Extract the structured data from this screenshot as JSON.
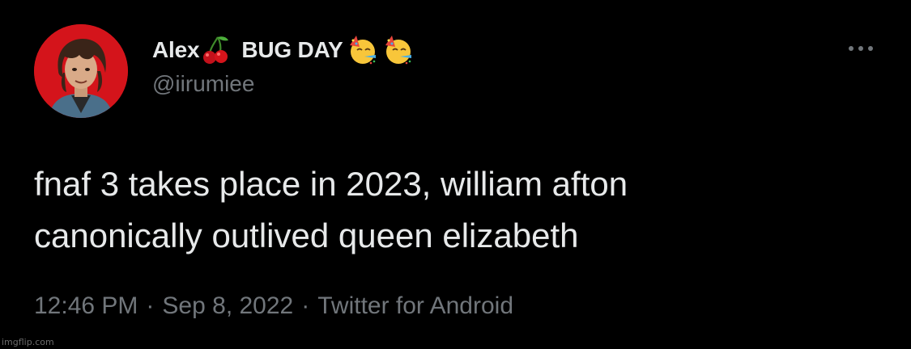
{
  "tweet": {
    "display_name": "Alex",
    "display_name_suffix": "BUG DAY",
    "name_emojis": [
      "cherries-icon",
      "partying-face-icon",
      "partying-face-icon"
    ],
    "handle": "@iirumiee",
    "text_line_1": "fnaf 3 takes place in 2023, william afton",
    "text_line_2": "canonically outlived queen elizabeth",
    "time": "12:46 PM",
    "date": "Sep 8, 2022",
    "source": "Twitter for Android",
    "separator": "·"
  },
  "watermark": "imgflip.com",
  "colors": {
    "background": "#000000",
    "primary_text": "#e7e9ea",
    "secondary_text": "#71767b",
    "avatar_background": "#d4141b"
  }
}
